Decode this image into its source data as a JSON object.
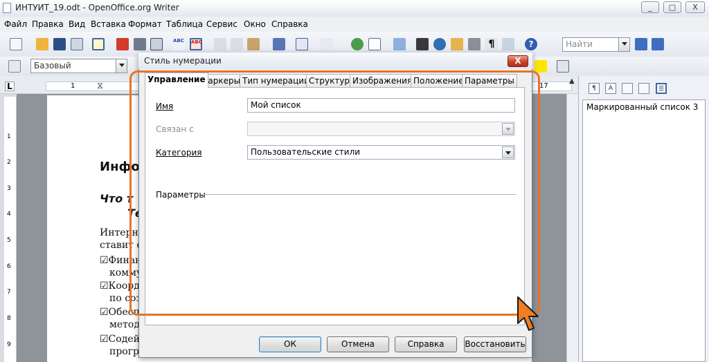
{
  "app": {
    "window_title": "ИНТУИТ_19.odt - OpenOffice.org Writer",
    "win_min": "_",
    "win_max": "□",
    "win_close": "X"
  },
  "menu": [
    "Файл",
    "Правка",
    "Вид",
    "Вставка",
    "Формат",
    "Таблица",
    "Сервис",
    "Окно",
    "Справка"
  ],
  "toolbar": {
    "search_placeholder": "Найти",
    "style_value": "Базовый"
  },
  "document": {
    "heading1": "Инфо",
    "heading2a": "Что т",
    "heading2b": "Те",
    "para1a": "Интерне",
    "para1b": "ставит с",
    "item1a": "☑Финан",
    "item1b": "комму",
    "item2a": "☑Коорд",
    "item2b": "по соз",
    "item3a": "☑Обесп",
    "item3b": "метод",
    "item4a": "☑Содей",
    "item4b": "програ"
  },
  "ruler": {
    "mark_1": "1",
    "mark_17": "17"
  },
  "vruler_marks": [
    "1",
    "1",
    "2",
    "3",
    "4",
    "5",
    "6",
    "7",
    "8",
    "9"
  ],
  "stylist": {
    "selected_item": "Маркированный список 3"
  },
  "dialog": {
    "title": "Стиль нумерации",
    "close": "X",
    "tabs": [
      "Управление",
      "Маркеры",
      "Тип нумерации",
      "Структура",
      "Изображения",
      "Положение",
      "Параметры"
    ],
    "active_tab": "Управление",
    "name_label": "Имя",
    "name_value": "Мой список",
    "linked_label": "Связан с",
    "linked_value": "",
    "category_label": "Категория",
    "category_value": "Пользовательские стили",
    "params_label": "Параметры",
    "buttons": {
      "ok": "ОК",
      "cancel": "Отмена",
      "help": "Справка",
      "reset": "Восстановить"
    }
  },
  "colors": {
    "highlight": "#ea7224",
    "accent": "#3c7fb1",
    "close_button": "#c8442c"
  }
}
